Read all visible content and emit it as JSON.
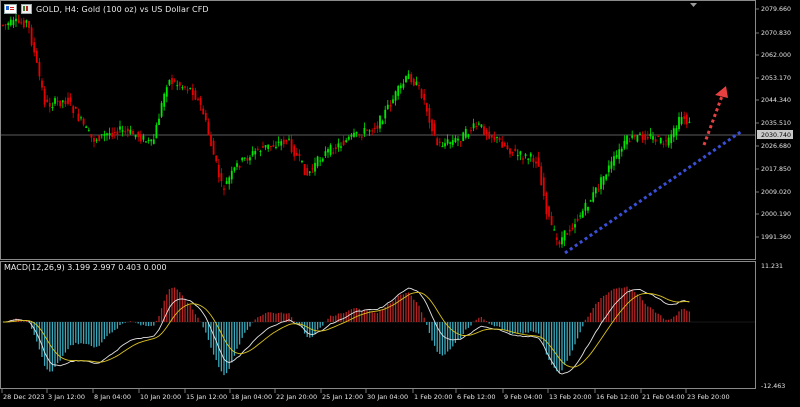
{
  "header": {
    "title": "GOLD, H4:  Gold (100 oz) vs US Dollar CFD"
  },
  "price_axis": {
    "labels": [
      "2079.660",
      "2070.830",
      "2062.000",
      "2053.170",
      "2044.340",
      "2035.510",
      "2030.740",
      "2026.680",
      "2017.850",
      "2009.020",
      "2000.190",
      "1991.360"
    ],
    "current_price": "2030.740"
  },
  "macd": {
    "label": "MACD(12,26,9) 3.199 2.997 0.403 0.000",
    "axis_top": "11.231",
    "axis_bottom": "-12.463"
  },
  "time_axis": {
    "labels": [
      "28 Dec 2023",
      "3 Jan 12:00",
      "8 Jan 04:00",
      "10 Jan 20:00",
      "15 Jan 12:00",
      "18 Jan 04:00",
      "22 Jan 20:00",
      "25 Jan 12:00",
      "30 Jan 04:00",
      "1 Feb 20:00",
      "6 Feb 12:00",
      "9 Feb 04:00",
      "13 Feb 20:00",
      "16 Feb 12:00",
      "21 Feb 04:00",
      "23 Feb 20:00"
    ]
  },
  "colors": {
    "background": "#000000",
    "bull_candle": "#00e600",
    "bear_candle": "#e60000",
    "macd_hist_positive": "#b52323",
    "macd_hist_negative": "#3aa9bd",
    "macd_main_line": "#e3e3e3",
    "macd_signal_line": "#d9c21f",
    "trendline": "#3a4fd6",
    "projection_arrow": "#e84040"
  },
  "annotations": [
    {
      "name": "support-trendline",
      "style": "dotted",
      "color": "blue"
    },
    {
      "name": "projection-arrow",
      "style": "dotted",
      "color": "red",
      "direction": "up"
    }
  ],
  "icons": {
    "symbol": "symbol-flag-icon",
    "indicator": "indicator-icon",
    "scroll_marker": "scroll-marker-icon"
  }
}
